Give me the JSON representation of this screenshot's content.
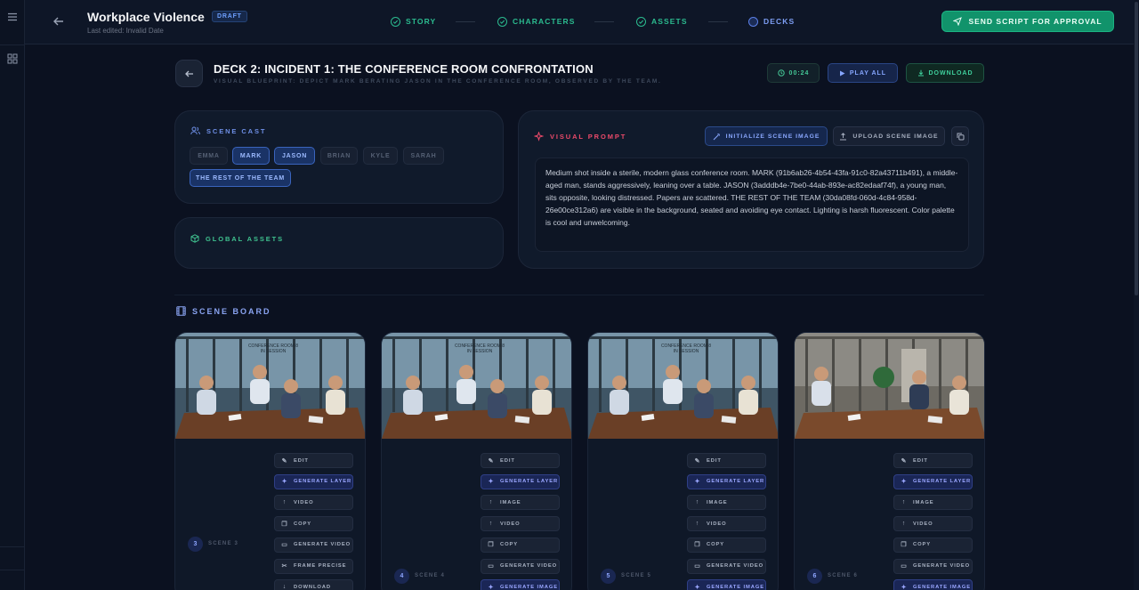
{
  "header": {
    "project_title": "Workplace Violence",
    "draft_badge": "DRAFT",
    "last_edited": "Last edited: Invalid Date",
    "steps": [
      {
        "label": "STORY",
        "state": "done"
      },
      {
        "label": "CHARACTERS",
        "state": "done"
      },
      {
        "label": "ASSETS",
        "state": "done"
      },
      {
        "label": "DECKS",
        "state": "active"
      }
    ],
    "send_button": "SEND SCRIPT FOR APPROVAL"
  },
  "deck": {
    "title": "DECK 2: INCIDENT 1: THE CONFERENCE ROOM CONFRONTATION",
    "subtitle": "VISUAL BLUEPRINT: DEPICT MARK BERATING JASON IN THE CONFERENCE ROOM, OBSERVED BY THE TEAM.",
    "timer": "00:24",
    "play_all": "PLAY ALL",
    "download": "DOWNLOAD"
  },
  "scene_cast": {
    "title": "SCENE CAST",
    "members": [
      {
        "name": "EMMA",
        "selected": false
      },
      {
        "name": "MARK",
        "selected": true
      },
      {
        "name": "JASON",
        "selected": true
      },
      {
        "name": "BRIAN",
        "selected": false
      },
      {
        "name": "KYLE",
        "selected": false
      },
      {
        "name": "SARAH",
        "selected": false
      },
      {
        "name": "THE REST OF THE TEAM",
        "selected": true
      }
    ]
  },
  "global_assets": {
    "title": "GLOBAL ASSETS"
  },
  "visual_prompt": {
    "title": "VISUAL PROMPT",
    "initialize_button": "INITIALIZE SCENE IMAGE",
    "upload_button": "UPLOAD SCENE IMAGE",
    "text": "Medium shot inside a sterile, modern glass conference room. MARK (91b6ab26-4b54-43fa-91c0-82a43711b491), a middle-aged man, stands aggressively, leaning over a table. JASON (3adddb4e-7be0-44ab-893e-ac82edaaf74f), a young man, sits opposite, looking distressed. Papers are scattered. THE REST OF THE TEAM (30da08fd-060d-4c84-958d-26e00ce312a6) are visible in the background, seated and avoiding eye contact. Lighting is harsh fluorescent. Color palette is cool and unwelcoming."
  },
  "scene_board": {
    "title": "SCENE BOARD",
    "scenes": [
      {
        "number": "3",
        "label": "SCENE 3",
        "thumb_caption": "CONFERENCE ROOM 8\nIN SESSION",
        "buttons": [
          "EDIT",
          "GENERATE LAYER",
          "VIDEO",
          "COPY",
          "GENERATE VIDEO",
          "FRAME PRECISE",
          "DOWNLOAD"
        ]
      },
      {
        "number": "4",
        "label": "SCENE 4",
        "thumb_caption": "CONFERENCE ROOM 8\nIN SESSION",
        "buttons": [
          "EDIT",
          "GENERATE LAYER",
          "IMAGE",
          "VIDEO",
          "COPY",
          "GENERATE VIDEO",
          "GENERATE IMAGE"
        ]
      },
      {
        "number": "5",
        "label": "SCENE 5",
        "thumb_caption": "CONFERENCE ROOM 8\nIN SESSION",
        "buttons": [
          "EDIT",
          "GENERATE LAYER",
          "IMAGE",
          "VIDEO",
          "COPY",
          "GENERATE VIDEO",
          "GENERATE IMAGE"
        ]
      },
      {
        "number": "6",
        "label": "SCENE 6",
        "thumb_caption": "",
        "buttons": [
          "EDIT",
          "GENERATE LAYER",
          "IMAGE",
          "VIDEO",
          "COPY",
          "GENERATE VIDEO",
          "GENERATE IMAGE"
        ]
      }
    ]
  },
  "colors": {
    "accent_green": "#11936b",
    "accent_blue": "#5b7fe6",
    "background": "#0b1120"
  }
}
